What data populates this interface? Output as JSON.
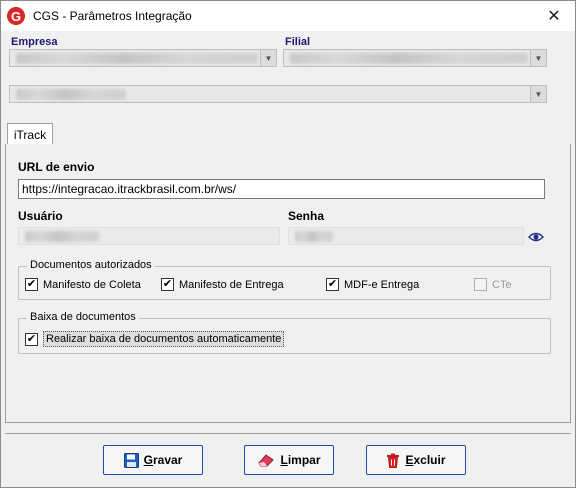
{
  "window": {
    "title": "CGS - Parâmetros Integração",
    "logo_letter": "G"
  },
  "header": {
    "empresa_label": "Empresa",
    "filial_label": "Filial"
  },
  "tabs": [
    {
      "label": "iTrack"
    }
  ],
  "form": {
    "url_label": "URL de envio",
    "url_value": "https://integracao.itrackbrasil.com.br/ws/",
    "usuario_label": "Usuário",
    "senha_label": "Senha"
  },
  "documentos": {
    "title": "Documentos autorizados",
    "items": [
      {
        "label": "Manifesto de Coleta",
        "checked": true,
        "enabled": true
      },
      {
        "label": "Manifesto de Entrega",
        "checked": true,
        "enabled": true
      },
      {
        "label": "MDF-e Entrega",
        "checked": true,
        "enabled": true
      },
      {
        "label": "CTe",
        "checked": false,
        "enabled": false
      }
    ]
  },
  "baixa": {
    "title": "Baixa de documentos",
    "auto_label": "Realizar baixa de documentos automaticamente",
    "auto_checked": true
  },
  "buttons": {
    "gravar": {
      "first": "G",
      "rest": "ravar"
    },
    "limpar": {
      "first": "L",
      "rest": "impar"
    },
    "excluir": {
      "first": "E",
      "rest": "xcluir"
    }
  },
  "icons": {
    "logo": "cgs-logo-icon",
    "close": "close-icon",
    "eye": "eye-icon",
    "save": "floppy-disk-icon",
    "eraser": "eraser-icon",
    "trash": "trash-icon"
  },
  "colors": {
    "label_blue": "#1a1a6e",
    "button_border": "#1e4ea8",
    "logo_red": "#d62828"
  }
}
